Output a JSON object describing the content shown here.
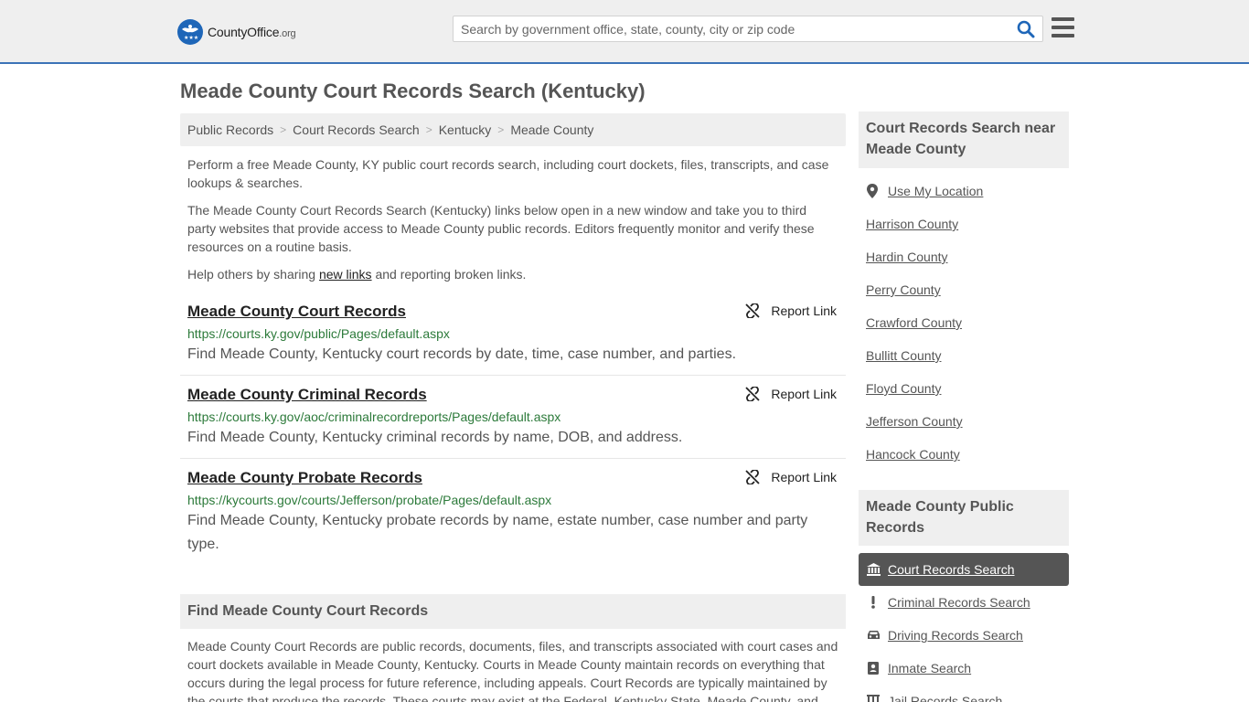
{
  "header": {
    "logo_county": "County",
    "logo_office": "Office",
    "logo_org": ".org",
    "search_placeholder": "Search by government office, state, county, city or zip code"
  },
  "page": {
    "title": "Meade County Court Records Search (Kentucky)"
  },
  "breadcrumb": [
    "Public Records",
    "Court Records Search",
    "Kentucky",
    "Meade County"
  ],
  "intro": {
    "p1": "Perform a free Meade County, KY public court records search, including court dockets, files, transcripts, and case lookups & searches.",
    "p2": "The Meade County Court Records Search (Kentucky) links below open in a new window and take you to third party websites that provide access to Meade County public records. Editors frequently monitor and verify these resources on a routine basis.",
    "p3_before": "Help others by sharing ",
    "p3_link": "new links",
    "p3_after": " and reporting broken links."
  },
  "report_label": "Report Link",
  "records": [
    {
      "title": "Meade County Court Records",
      "url": "https://courts.ky.gov/public/Pages/default.aspx",
      "description": "Find Meade County, Kentucky court records by date, time, case number, and parties."
    },
    {
      "title": "Meade County Criminal Records",
      "url": "https://courts.ky.gov/aoc/criminalrecordreports/Pages/default.aspx",
      "description": "Find Meade County, Kentucky criminal records by name, DOB, and address."
    },
    {
      "title": "Meade County Probate Records",
      "url": "https://kycourts.gov/courts/Jefferson/probate/Pages/default.aspx",
      "description": "Find Meade County, Kentucky probate records by name, estate number, case number and party type."
    }
  ],
  "find_section": {
    "heading": "Find Meade County Court Records",
    "text": "Meade County Court Records are public records, documents, files, and transcripts associated with court cases and court dockets available in Meade County, Kentucky. Courts in Meade County maintain records on everything that occurs during the legal process for future reference, including appeals. Court Records are typically maintained by the courts that produce the records. These courts may exist at the Federal, Kentucky State, Meade County, and"
  },
  "sidebar": {
    "near_heading": "Court Records Search near Meade County",
    "use_location": "Use My Location",
    "near_counties": [
      "Harrison County",
      "Hardin County",
      "Perry County",
      "Crawford County",
      "Bullitt County",
      "Floyd County",
      "Jefferson County",
      "Hancock County"
    ],
    "public_heading": "Meade County Public Records",
    "public_items": [
      {
        "label": "Court Records Search",
        "icon": "courthouse-icon",
        "active": true
      },
      {
        "label": "Criminal Records Search",
        "icon": "exclamation-icon",
        "active": false
      },
      {
        "label": "Driving Records Search",
        "icon": "car-icon",
        "active": false
      },
      {
        "label": "Inmate Search",
        "icon": "id-card-icon",
        "active": false
      },
      {
        "label": "Jail Records Search",
        "icon": "jail-icon",
        "active": false
      }
    ]
  },
  "colors": {
    "header_bg": "#efefef",
    "header_border": "#3c73b7",
    "url_green": "#2c7a3a",
    "active_item_bg": "#555555",
    "logo_blue": "#1e66b8"
  }
}
